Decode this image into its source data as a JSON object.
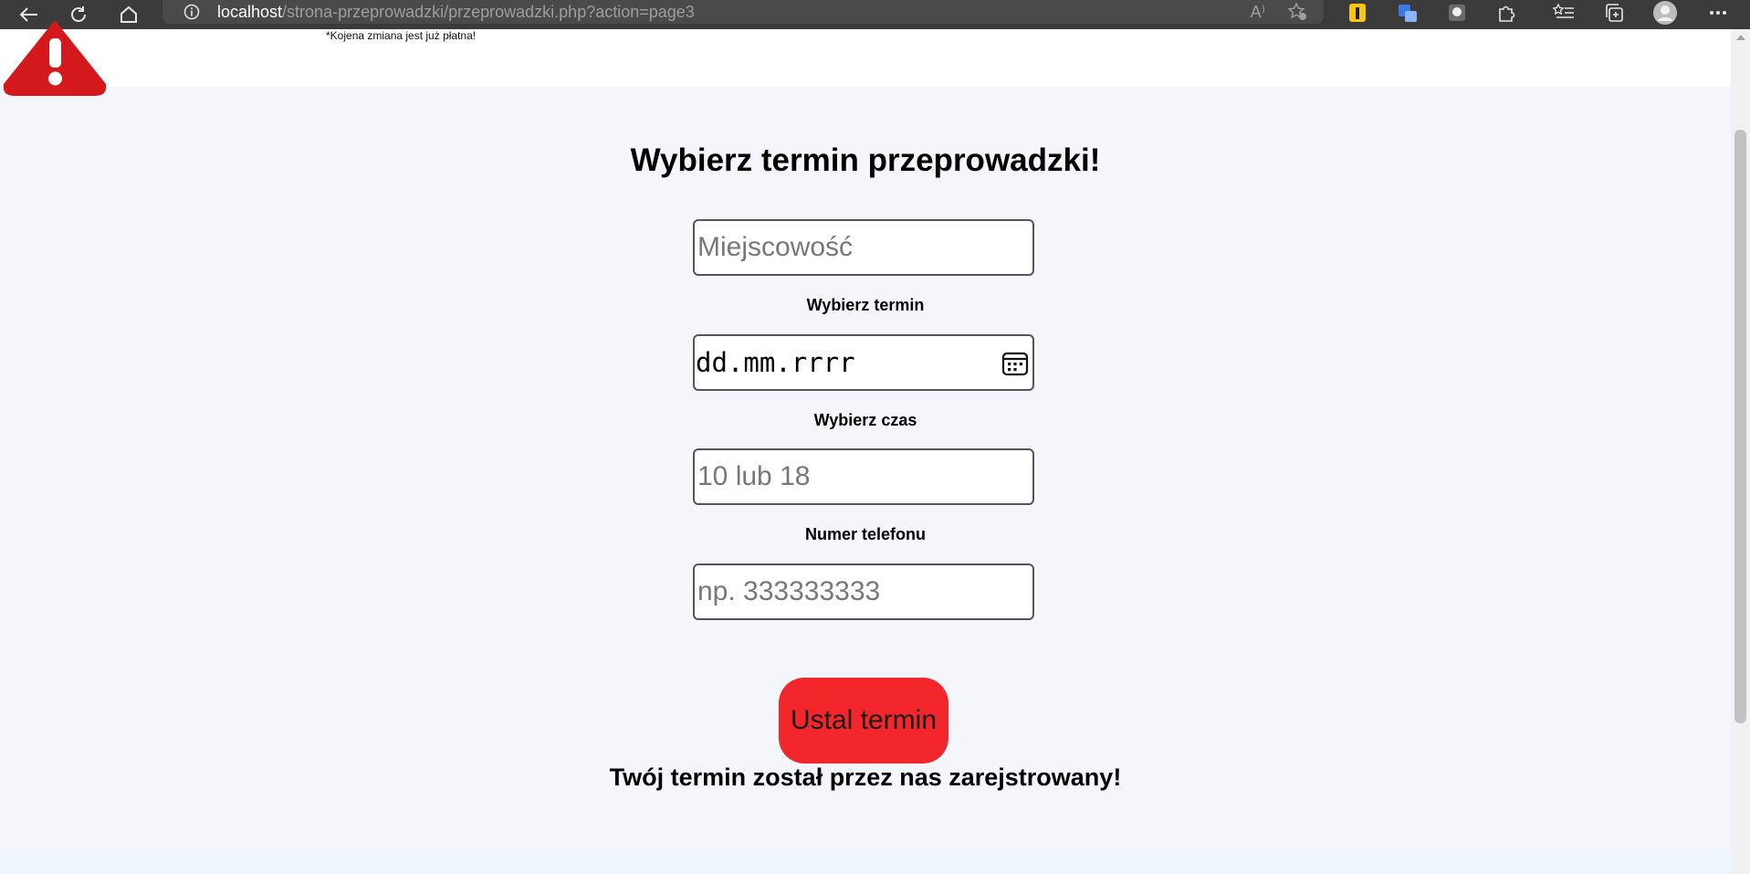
{
  "browser": {
    "url_host": "localhost",
    "url_path": "/strona-przeprowadzki/przeprowadzki.php?action=page3",
    "read_aloud_label": "A⁾"
  },
  "page": {
    "note": "*Kojena zmiana jest już płatna!",
    "title": "Wybierz termin przeprowadzki!",
    "city": {
      "placeholder": "Miejscowość",
      "value": ""
    },
    "date": {
      "label": "Wybierz termin",
      "placeholder": "dd.mm.rrrr"
    },
    "time": {
      "label": "Wybierz czas",
      "placeholder": "10 lub 18",
      "value": ""
    },
    "phone": {
      "label": "Numer telefonu",
      "placeholder": "np. 333333333",
      "value": ""
    },
    "submit_label": "Ustal termin",
    "success_message": "Twój termin został przez nas zarejstrowany!"
  },
  "colors": {
    "accent_red": "#f2262b",
    "page_background": "#f4f6fc",
    "chrome": "#3b3b3b"
  }
}
